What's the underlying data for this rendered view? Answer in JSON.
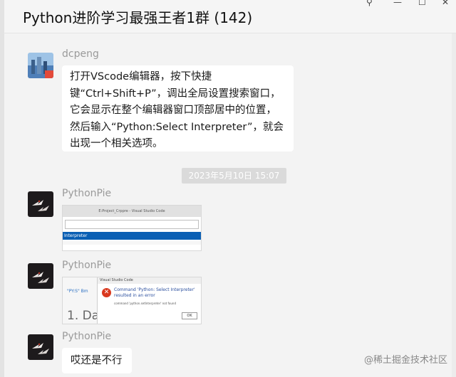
{
  "window": {
    "title": "Python进阶学习最强王者1群 (142)",
    "controls": {
      "pin": "⚲",
      "minimize": "—",
      "maximize": "☐",
      "close": "✕"
    }
  },
  "messages": [
    {
      "sender": "dcpeng",
      "text": "打开VScode编辑器，按下快捷键“Ctrl+Shift+P”，调出全局设置搜索窗口，它会显示在整个编辑器窗口顶部居中的位置，然后输入“Python:Select Interpreter”，就会出现一个相关选项。"
    },
    {
      "timestamp": "2023年5月10日 15:07"
    },
    {
      "sender": "PythonPie",
      "image": {
        "window_title": "E:Project_Crppre - Visual Studio Code",
        "highlight_text": "Interpreter"
      }
    },
    {
      "sender": "PythonPie",
      "image": {
        "dialog_title": "Visual Studio Code",
        "error_line1": "Command 'Python: Select Interpreter'",
        "error_line2": "resulted in an error",
        "detail": "command 'python.setInterpreter' not found",
        "ok": "OK",
        "bg_small": "\"PY:S\" Bm",
        "bg_big": "1. Dat"
      }
    },
    {
      "sender": "PythonPie",
      "text": "哎还是不行"
    }
  ],
  "watermark": "@稀土掘金技术社区",
  "colors": {
    "chat_bg": "#f3f3f3",
    "header_bg": "#f5f5f5",
    "bubble_bg": "#ffffff",
    "vscode_selection": "#0a5fb4",
    "error_icon": "#d9381e"
  }
}
